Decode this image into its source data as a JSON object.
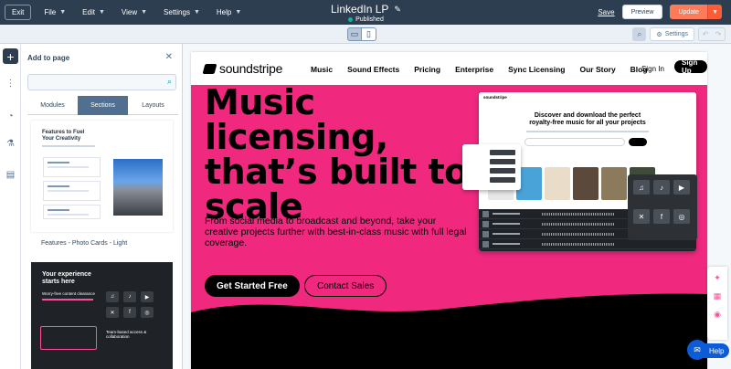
{
  "topbar": {
    "exit_label": "Exit",
    "menu": [
      {
        "label": "File"
      },
      {
        "label": "Edit"
      },
      {
        "label": "View"
      },
      {
        "label": "Settings"
      },
      {
        "label": "Help"
      }
    ],
    "page_title": "LinkedIn LP",
    "status": "Published",
    "save_label": "Save",
    "preview_label": "Preview",
    "update_label": "Update"
  },
  "toolbar": {
    "settings_label": "Settings",
    "devices": [
      "desktop-icon",
      "mobile-icon"
    ]
  },
  "panel": {
    "title": "Add to page",
    "search_placeholder": "",
    "tabs": [
      {
        "label": "Modules",
        "active": false
      },
      {
        "label": "Sections",
        "active": true
      },
      {
        "label": "Layouts",
        "active": false
      }
    ],
    "card1": {
      "heading_line1": "Features to Fuel",
      "heading_line2": "Your Creativity",
      "label": "Features - Photo Cards - Light"
    },
    "card2": {
      "heading_line1": "Your experience",
      "heading_line2": "starts here",
      "sub": "Worry-free content clearance",
      "note_line1": "Team-based access &",
      "note_line2": "collaboration"
    }
  },
  "site": {
    "logo": "soundstripe",
    "nav": [
      "Music",
      "Sound Effects",
      "Pricing",
      "Enterprise",
      "Sync Licensing",
      "Our Story",
      "Blog"
    ],
    "sign_in": "Sign In",
    "sign_up": "Sign Up",
    "hero_line1": "Music",
    "hero_line2": "licensing,",
    "hero_line3": "that’s built to",
    "hero_line4": "scale",
    "subtitle": "From social media to broadcast and beyond, take your creative projects further with best-in-class music with full legal coverage.",
    "cta_primary": "Get Started Free",
    "cta_secondary": "Contact Sales",
    "mock_heading_line1": "Discover and download the perfect",
    "mock_heading_line2": "royalty-free music for all your projects",
    "mock_logo": "soundstripe"
  },
  "help_label": "Help",
  "colors": {
    "topbar": "#2d3e50",
    "accent": "#ff7a59",
    "hero": "#f0297f",
    "published": "#00bda5"
  }
}
